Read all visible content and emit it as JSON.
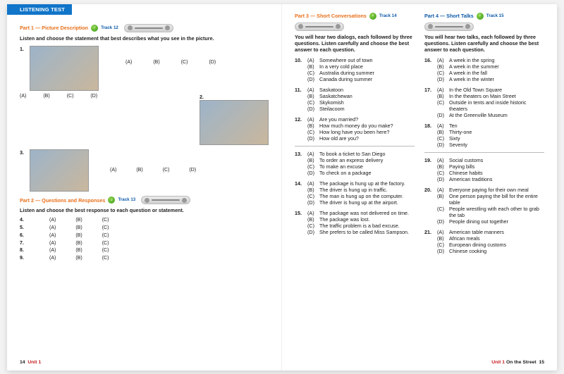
{
  "tab": "LISTENING TEST",
  "left": {
    "part1": {
      "title": "Part 1 — Picture Description",
      "track": "Track 12",
      "instruct": "Listen and choose the statement that best describes what you see in the picture.",
      "q1": "1.",
      "q2": "2.",
      "q3": "3.",
      "opts": {
        "a": "(A)",
        "b": "(B)",
        "c": "(C)",
        "d": "(D)"
      }
    },
    "part2": {
      "title": "Part 2 — Questions and Responses",
      "track": "Track 13",
      "instruct": "Listen and choose the best response to each question or statement.",
      "rows": [
        {
          "n": "4.",
          "a": "(A)",
          "b": "(B)",
          "c": "(C)"
        },
        {
          "n": "5.",
          "a": "(A)",
          "b": "(B)",
          "c": "(C)"
        },
        {
          "n": "6.",
          "a": "(A)",
          "b": "(B)",
          "c": "(C)"
        },
        {
          "n": "7.",
          "a": "(A)",
          "b": "(B)",
          "c": "(C)"
        },
        {
          "n": "8.",
          "a": "(A)",
          "b": "(B)",
          "c": "(C)"
        },
        {
          "n": "9.",
          "a": "(A)",
          "b": "(B)",
          "c": "(C)"
        }
      ]
    },
    "footer_page": "14",
    "footer_unit": "Unit 1"
  },
  "right": {
    "part3": {
      "title": "Part 3 — Short Conversations",
      "track": "Track 14",
      "instruct": "You will hear two dialogs, each followed by three questions. Listen carefully and choose the best answer to each question.",
      "q": [
        {
          "n": "10.",
          "opts": [
            "Somewhere out of town",
            "In a very cold place",
            "Australia during summer",
            "Canada during summer"
          ]
        },
        {
          "n": "11.",
          "opts": [
            "Saskatoon",
            "Saskatchewan",
            "Skykomish",
            "Steilacoom"
          ]
        },
        {
          "n": "12.",
          "opts": [
            "Are you married?",
            "How much money do you make?",
            "How long have you been here?",
            "How old are you?"
          ]
        },
        {
          "n": "13.",
          "opts": [
            "To book a ticket to San Diego",
            "To order an express delivery",
            "To make an excuse",
            "To check on a package"
          ]
        },
        {
          "n": "14.",
          "opts": [
            "The package is hung up at the factory.",
            "The driver is hung up in traffic.",
            "The man is hung up on the computer.",
            "The driver is hung up at the airport."
          ]
        },
        {
          "n": "15.",
          "opts": [
            "The package was not delivered on time.",
            "The package was lost.",
            "The traffic problem is a bad excuse.",
            "She prefers to be called Miss Sampson."
          ]
        }
      ]
    },
    "part4": {
      "title": "Part 4 — Short Talks",
      "track": "Track 15",
      "instruct": "You will hear two talks, each followed by three questions. Listen carefully and choose the best answer to each question.",
      "q": [
        {
          "n": "16.",
          "opts": [
            "A week in the spring",
            "A week in the summer",
            "A week in the fall",
            "A week in the winter"
          ]
        },
        {
          "n": "17.",
          "opts": [
            "In the Old Town Square",
            "In the theaters on Main Street",
            "Outside in tents and inside historic theaters",
            "At the Greenville Museum"
          ]
        },
        {
          "n": "18.",
          "opts": [
            "Ten",
            "Thirty-one",
            "Sixty",
            "Seventy"
          ]
        },
        {
          "n": "19.",
          "opts": [
            "Social customs",
            "Paying bills",
            "Chinese habits",
            "American traditions"
          ]
        },
        {
          "n": "20.",
          "opts": [
            "Everyone paying for their own meal",
            "One person paying the bill for the entire table",
            "People wrestling with each other to grab the tab",
            "People dining out together"
          ]
        },
        {
          "n": "21.",
          "opts": [
            "American table manners",
            "African meals",
            "European dining customs",
            "Chinese cooking"
          ]
        }
      ]
    },
    "footer_unit": "Unit 1",
    "footer_title": "On the Street",
    "footer_page": "15"
  },
  "labels": {
    "a": "(A)",
    "b": "(B)",
    "c": "(C)",
    "d": "(D)"
  }
}
